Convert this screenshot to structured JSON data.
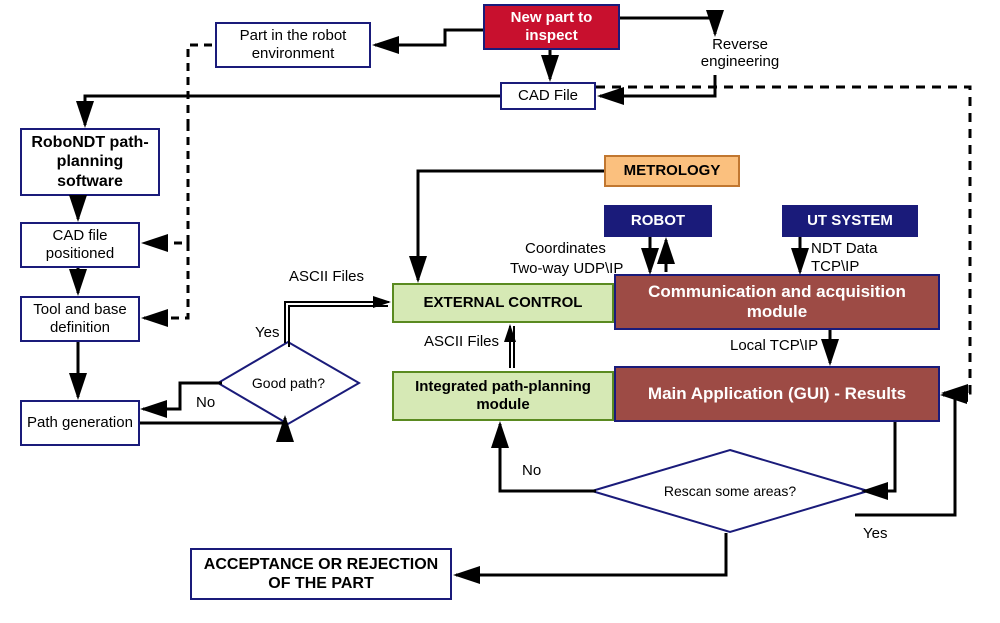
{
  "boxes": {
    "newPart": "New part to inspect",
    "robotEnv": "Part in the robot environment",
    "reverseEng": "Reverse engineering",
    "cadFile": "CAD File",
    "roboNDT": "RoboNDT path-planning software",
    "cadPositioned": "CAD file positioned",
    "toolBase": "Tool and base definition",
    "pathGen": "Path generation",
    "metrology": "METROLOGY",
    "robot": "ROBOT",
    "utSystem": "UT SYSTEM",
    "externalControl": "EXTERNAL CONTROL",
    "commModule": "Communication and acquisition module",
    "integratedPath": "Integrated path‑planning module",
    "mainApp": "Main Application (GUI) - Results",
    "acceptance": "ACCEPTANCE OR REJECTION OF THE PART"
  },
  "decisions": {
    "goodPath": "Good path?",
    "rescan": "Rescan some areas?"
  },
  "labels": {
    "ascii1": "ASCII Files",
    "ascii2": "ASCII Files",
    "coords": "Coordinates",
    "twoWay": "Two-way UDP\\IP",
    "ndtData": "NDT Data",
    "tcpip": "TCP\\IP",
    "localTcp": "Local TCP\\IP",
    "yes1": "Yes",
    "no1": "No",
    "yes2": "Yes",
    "no2": "No"
  }
}
